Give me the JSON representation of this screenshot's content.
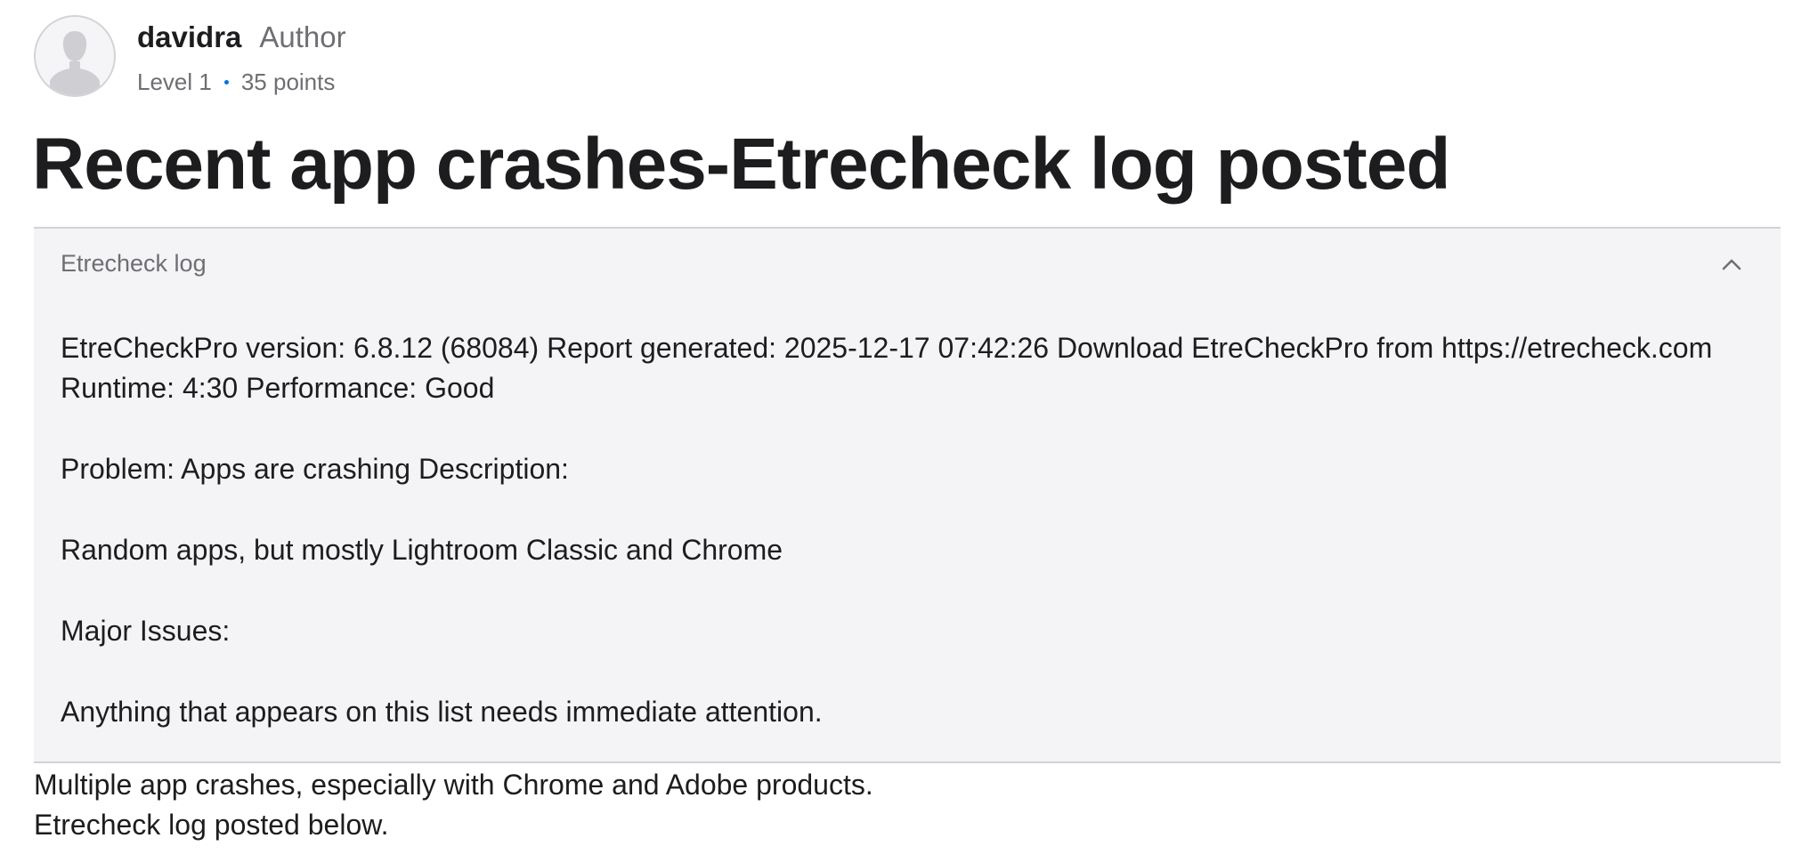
{
  "author": {
    "name": "davidra",
    "role": "Author",
    "level": "Level 1",
    "points": "35 points"
  },
  "post": {
    "title": "Recent app crashes-Etrecheck log posted"
  },
  "log": {
    "header": "Etrecheck log",
    "toggle_icon": "chevron-up-icon",
    "paragraphs": [
      "EtreCheckPro version: 6.8.12 (68084) Report generated: 2025-12-17 07:42:26 Download EtreCheckPro from https://etrecheck.com Runtime: 4:30 Performance: Good",
      "Problem: Apps are crashing Description:",
      "Random apps, but mostly Lightroom Classic and Chrome",
      "Major Issues:",
      "Anything that appears on this list needs immediate attention."
    ]
  },
  "body": {
    "lines": [
      "Multiple app crashes, especially with Chrome and Adobe products.",
      "Etrecheck log posted below."
    ]
  },
  "colors": {
    "accent": "#0071e3",
    "log_background": "#f4f4f6",
    "text": "#1d1d1f",
    "muted": "#6e6e73"
  }
}
